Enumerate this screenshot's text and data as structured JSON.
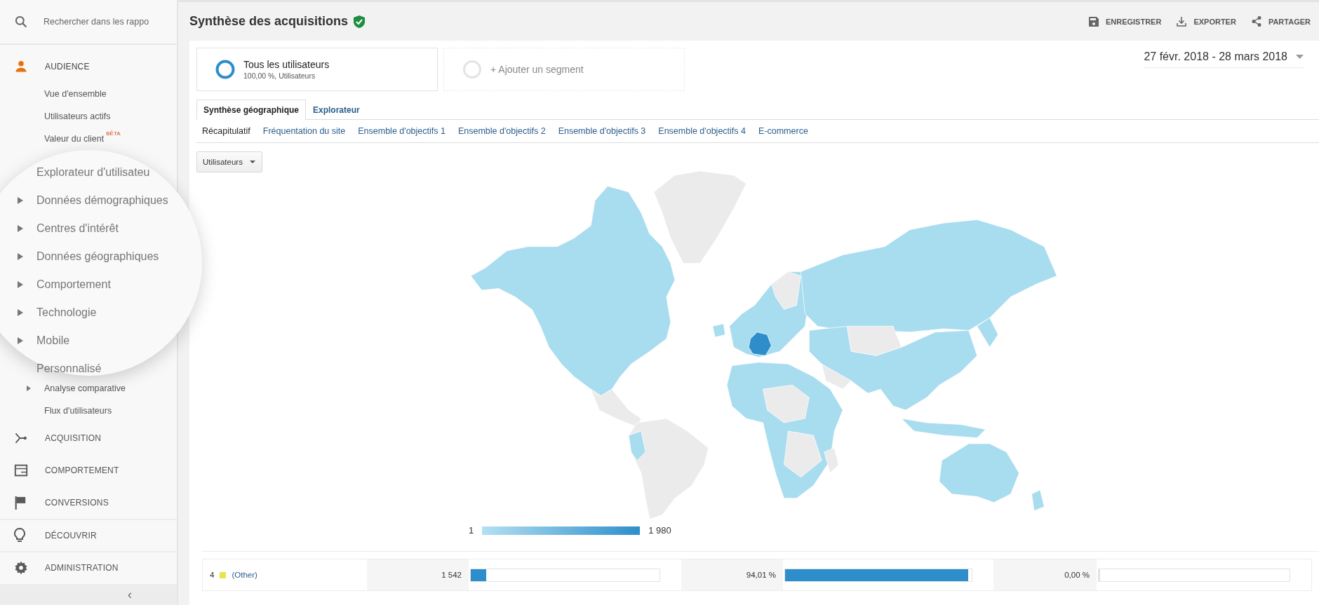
{
  "sidebar": {
    "search": {
      "placeholder": "Rechercher dans les rappo"
    },
    "sections": [
      {
        "label": "AUDIENCE",
        "kind": "report",
        "selected": true,
        "items": [
          {
            "label": "Vue d'ensemble",
            "expandable": false
          },
          {
            "label": "Utilisateurs actifs",
            "expandable": false
          },
          {
            "label": "Valeur du client",
            "badge": "BÊTA",
            "expandable": false
          }
        ],
        "magnifier": {
          "items": [
            {
              "label": "Explorateur d'utilisateu",
              "expandable": false
            },
            {
              "label": "Données démographiques",
              "expandable": true
            },
            {
              "label": "Centres d'intérêt",
              "expandable": true
            },
            {
              "label": "Données géographiques",
              "expandable": true
            },
            {
              "label": "Comportement",
              "expandable": true
            },
            {
              "label": "Technologie",
              "expandable": true
            },
            {
              "label": "Mobile",
              "expandable": true
            },
            {
              "label": "Personnalisé",
              "expandable": false
            }
          ]
        },
        "more_items": [
          {
            "label": "Analyse comparative",
            "expandable": true
          },
          {
            "label": "Flux d'utilisateurs",
            "expandable": false
          }
        ]
      },
      {
        "label": "ACQUISITION",
        "kind": "report",
        "selected": false
      },
      {
        "label": "COMPORTEMENT",
        "kind": "report",
        "selected": false
      },
      {
        "label": "CONVERSIONS",
        "kind": "report",
        "selected": false
      },
      {
        "label": "DÉCOUVRIR",
        "kind": "utility",
        "selected": false
      },
      {
        "label": "ADMINISTRATION",
        "kind": "utility",
        "selected": false
      }
    ],
    "collapse": "‹"
  },
  "header": {
    "title": "Synthèse des acquisitions",
    "verified": true,
    "actions": [
      {
        "label": "ENREGISTRER"
      },
      {
        "label": "EXPORTER"
      },
      {
        "label": "PARTAGER"
      }
    ]
  },
  "segments": [
    {
      "kind": "active",
      "name": "Tous les utilisateurs",
      "detail": "100,00 %, Utilisateurs"
    },
    {
      "kind": "add",
      "name": "+ Ajouter un segment"
    }
  ],
  "date_range": "27 févr. 2018 - 28 mars 2018",
  "tabs": [
    {
      "label": "Synthèse géographique",
      "selected": true
    },
    {
      "label": "Explorateur",
      "selected": false
    }
  ],
  "subtabs": [
    {
      "label": "Récapitulatif",
      "selected": true
    },
    {
      "label": "Fréquentation du site",
      "selected": false
    },
    {
      "label": "Ensemble d'objectifs 1",
      "selected": false
    },
    {
      "label": "Ensemble d'objectifs 2",
      "selected": false
    },
    {
      "label": "Ensemble d'objectifs 3",
      "selected": false
    },
    {
      "label": "Ensemble d'objectifs 4",
      "selected": false
    },
    {
      "label": "E-commerce",
      "selected": false
    }
  ],
  "metric_dropdown": {
    "value": "Utilisateurs"
  },
  "map": {
    "legend": {
      "min": "1",
      "max": "1 980"
    }
  },
  "table": {
    "rows": [
      {
        "rank": "4",
        "color": "#e5e54c",
        "name": "(Other)",
        "bars": [
          {
            "reading": "1 542",
            "level": 0.08
          },
          {
            "reading": "94,01 %",
            "level": 0.98
          },
          {
            "reading": "0,00 %",
            "level": 0
          }
        ]
      }
    ]
  }
}
